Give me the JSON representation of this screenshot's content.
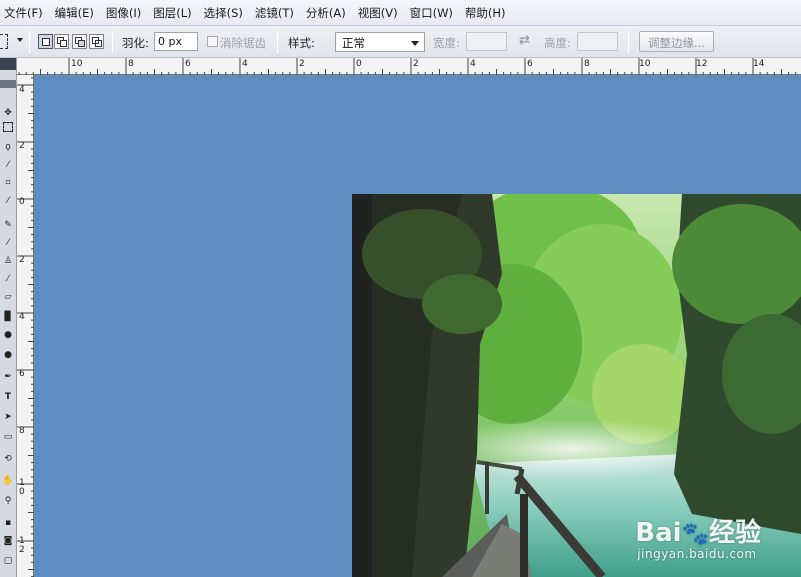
{
  "menu": [
    "文件(F)",
    "编辑(E)",
    "图像(I)",
    "图层(L)",
    "选择(S)",
    "滤镜(T)",
    "分析(A)",
    "视图(V)",
    "窗口(W)",
    "帮助(H)"
  ],
  "options": {
    "feather_label": "羽化:",
    "feather_value": "0 px",
    "antialias_label": "消除锯齿",
    "style_label": "样式:",
    "style_value": "正常",
    "width_label": "宽度:",
    "height_label": "高度:",
    "refine_edge_button": "调整边缘..."
  },
  "rulers": {
    "horizontal": [
      "10",
      "8",
      "6",
      "4",
      "2",
      "0",
      "2",
      "4",
      "6",
      "8",
      "10",
      "12",
      "14"
    ],
    "vertical": [
      "4",
      "2",
      "0",
      "2",
      "4",
      "6",
      "8",
      "10",
      "12"
    ]
  },
  "watermark": {
    "logo_text": "Bai",
    "logo_paw": "🐾",
    "logo_suffix": "经验",
    "url": "jingyan.baidu.com"
  },
  "colors": {
    "canvas_background": "#5e8dbf"
  },
  "icons": {
    "swap": "swap-arrows-icon",
    "dropdown": "chevron-down-icon"
  }
}
